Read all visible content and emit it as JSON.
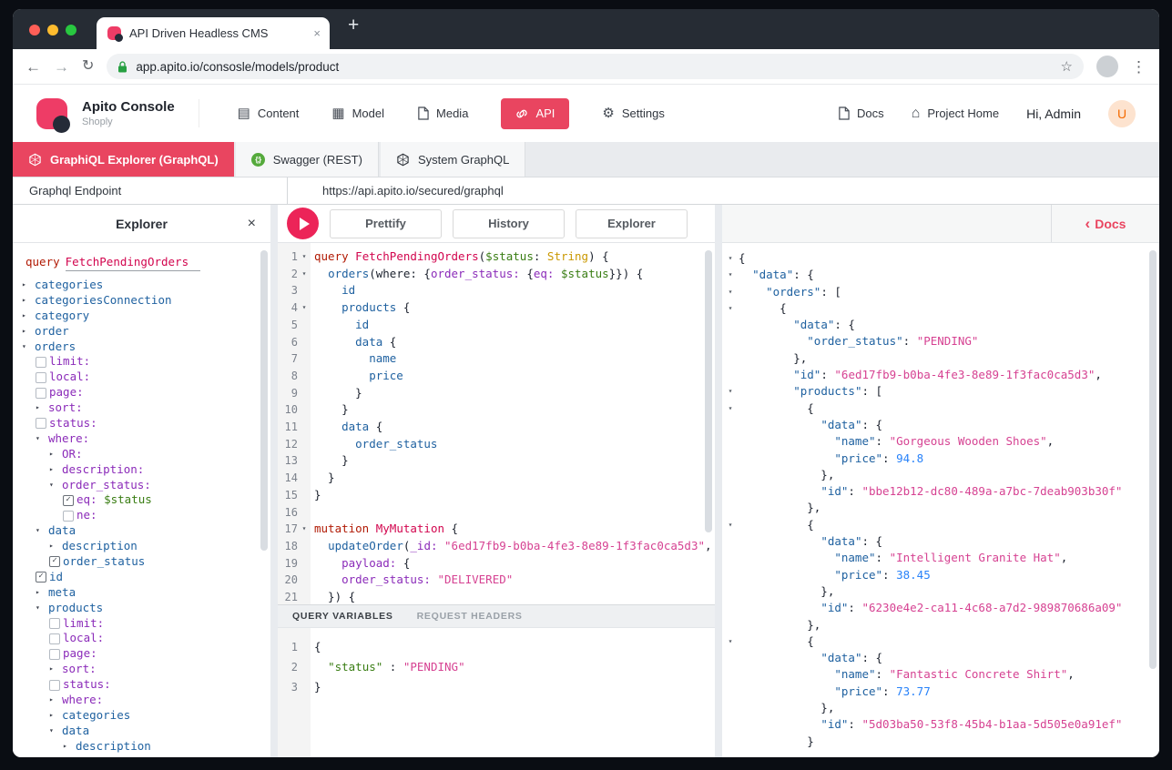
{
  "browser": {
    "tab_title": "API Driven Headless CMS",
    "tab_close": "×",
    "new_tab": "+",
    "back": "←",
    "forward": "→",
    "reload": "↻",
    "url": "app.apito.io/consosle/models/product",
    "star": "☆",
    "menu": "⋮"
  },
  "nav": {
    "brand": "Apito Console",
    "project": "Shoply",
    "items": [
      {
        "label": "Content"
      },
      {
        "label": "Model"
      },
      {
        "label": "Media"
      },
      {
        "label": "API",
        "active": true
      },
      {
        "label": "Settings"
      }
    ],
    "right": {
      "docs": "Docs",
      "project_home": "Project Home",
      "greeting": "Hi, Admin",
      "avatar": "U"
    }
  },
  "api_tabs": [
    {
      "label": "GraphiQL Explorer (GraphQL)",
      "icon": "graphql-icon",
      "active": true
    },
    {
      "label": "Swagger (REST)",
      "icon": "swagger-icon",
      "active": false
    },
    {
      "label": "System GraphQL",
      "icon": "graphql-icon",
      "active": false
    }
  ],
  "endpoint": {
    "label": "Graphql Endpoint",
    "url": "https://api.apito.io/secured/graphql"
  },
  "toolbar": {
    "explorer_title": "Explorer",
    "explorer_close": "×",
    "prettify": "Prettify",
    "history": "History",
    "explorer_btn": "Explorer",
    "docs_chevron": "‹",
    "docs": "Docs"
  },
  "variables_header": {
    "query_variables": "QUERY VARIABLES",
    "request_headers": "REQUEST HEADERS"
  },
  "colors": {
    "accent": "#e94560",
    "play_button": "#ec2458",
    "swagger_green": "#55aa3c",
    "lock_green": "#27a042",
    "traffic_lights": [
      "#ff5f57",
      "#febc2e",
      "#28c840"
    ],
    "avatar_bg": "#fde3cf",
    "avatar_text": "#f56a00",
    "syntax": {
      "keyword": "#b11a04",
      "def": "#d2054e",
      "field": "#1f61a0",
      "argument": "#8b2bb9",
      "variable": "#397d13",
      "type": "#ca9800",
      "string": "#d64292",
      "number": "#2882f9"
    }
  },
  "explorer_tree": {
    "operation": {
      "keyword": "query",
      "name": "FetchPendingOrders"
    },
    "rows": [
      {
        "i": 0,
        "m": "r",
        "t": [
          [
            "categories",
            "fld"
          ]
        ]
      },
      {
        "i": 0,
        "m": "r",
        "t": [
          [
            "categoriesConnection",
            "fld"
          ]
        ]
      },
      {
        "i": 0,
        "m": "r",
        "t": [
          [
            "category",
            "fld"
          ]
        ]
      },
      {
        "i": 0,
        "m": "r",
        "t": [
          [
            "order",
            "fld"
          ]
        ]
      },
      {
        "i": 0,
        "m": "d",
        "t": [
          [
            "orders",
            "fld"
          ]
        ]
      },
      {
        "i": 1,
        "c": false,
        "t": [
          [
            "limit:",
            "attr"
          ]
        ]
      },
      {
        "i": 1,
        "c": false,
        "t": [
          [
            "local:",
            "attr"
          ]
        ]
      },
      {
        "i": 1,
        "c": false,
        "t": [
          [
            "page:",
            "attr"
          ]
        ]
      },
      {
        "i": 1,
        "m": "r",
        "t": [
          [
            "sort:",
            "attr"
          ]
        ]
      },
      {
        "i": 1,
        "c": false,
        "t": [
          [
            "status:",
            "attr"
          ]
        ]
      },
      {
        "i": 1,
        "m": "d",
        "t": [
          [
            "where:",
            "attr"
          ]
        ]
      },
      {
        "i": 2,
        "m": "r",
        "t": [
          [
            "OR:",
            "attr"
          ]
        ]
      },
      {
        "i": 2,
        "m": "r",
        "t": [
          [
            "description:",
            "attr"
          ]
        ]
      },
      {
        "i": 2,
        "m": "d",
        "t": [
          [
            "order_status:",
            "attr"
          ]
        ]
      },
      {
        "i": 3,
        "c": true,
        "t": [
          [
            "eq:",
            "attr"
          ],
          [
            " ",
            "pl"
          ],
          [
            "$status",
            "var"
          ]
        ]
      },
      {
        "i": 3,
        "c": false,
        "t": [
          [
            "ne:",
            "attr"
          ]
        ]
      },
      {
        "i": 1,
        "m": "d",
        "t": [
          [
            "data",
            "fld"
          ]
        ]
      },
      {
        "i": 2,
        "m": "r",
        "t": [
          [
            "description",
            "fld"
          ]
        ]
      },
      {
        "i": 2,
        "c": true,
        "t": [
          [
            "order_status",
            "fld"
          ]
        ]
      },
      {
        "i": 1,
        "c": true,
        "t": [
          [
            "id",
            "fld"
          ]
        ]
      },
      {
        "i": 1,
        "m": "r",
        "t": [
          [
            "meta",
            "fld"
          ]
        ]
      },
      {
        "i": 1,
        "m": "d",
        "t": [
          [
            "products",
            "fld"
          ]
        ]
      },
      {
        "i": 2,
        "c": false,
        "t": [
          [
            "limit:",
            "attr"
          ]
        ]
      },
      {
        "i": 2,
        "c": false,
        "t": [
          [
            "local:",
            "attr"
          ]
        ]
      },
      {
        "i": 2,
        "c": false,
        "t": [
          [
            "page:",
            "attr"
          ]
        ]
      },
      {
        "i": 2,
        "m": "r",
        "t": [
          [
            "sort:",
            "attr"
          ]
        ]
      },
      {
        "i": 2,
        "c": false,
        "t": [
          [
            "status:",
            "attr"
          ]
        ]
      },
      {
        "i": 2,
        "m": "r",
        "t": [
          [
            "where:",
            "attr"
          ]
        ]
      },
      {
        "i": 2,
        "m": "r",
        "t": [
          [
            "categories",
            "fld"
          ]
        ]
      },
      {
        "i": 2,
        "m": "d",
        "t": [
          [
            "data",
            "fld"
          ]
        ]
      },
      {
        "i": 3,
        "m": "r",
        "t": [
          [
            "description",
            "fld"
          ]
        ]
      }
    ]
  },
  "editor": {
    "lines": [
      {
        "f": true,
        "t": [
          [
            "query",
            "kw"
          ],
          [
            " ",
            "pl"
          ],
          [
            "FetchPendingOrders",
            "def"
          ],
          [
            "(",
            "pl"
          ],
          [
            "$status",
            "var"
          ],
          [
            ": ",
            "pl"
          ],
          [
            "String",
            "type"
          ],
          [
            ") {",
            "pl"
          ]
        ]
      },
      {
        "f": true,
        "t": [
          [
            "  ",
            "pl"
          ],
          [
            "orders",
            "fld"
          ],
          [
            "(where: {",
            "pl"
          ],
          [
            "order_status:",
            "attr"
          ],
          [
            " {",
            "pl"
          ],
          [
            "eq:",
            "attr"
          ],
          [
            " ",
            "pl"
          ],
          [
            "$status",
            "var"
          ],
          [
            "}}) {",
            "pl"
          ]
        ]
      },
      {
        "t": [
          [
            "    id",
            "fld"
          ]
        ]
      },
      {
        "f": true,
        "t": [
          [
            "    ",
            "pl"
          ],
          [
            "products",
            "fld"
          ],
          [
            " {",
            "pl"
          ]
        ]
      },
      {
        "t": [
          [
            "      id",
            "fld"
          ]
        ]
      },
      {
        "t": [
          [
            "      ",
            "pl"
          ],
          [
            "data",
            "fld"
          ],
          [
            " {",
            "pl"
          ]
        ]
      },
      {
        "t": [
          [
            "        name",
            "fld"
          ]
        ]
      },
      {
        "t": [
          [
            "        price",
            "fld"
          ]
        ]
      },
      {
        "t": [
          [
            "      }",
            "pl"
          ]
        ]
      },
      {
        "t": [
          [
            "    }",
            "pl"
          ]
        ]
      },
      {
        "t": [
          [
            "    ",
            "pl"
          ],
          [
            "data",
            "fld"
          ],
          [
            " {",
            "pl"
          ]
        ]
      },
      {
        "t": [
          [
            "      order_status",
            "fld"
          ]
        ]
      },
      {
        "t": [
          [
            "    }",
            "pl"
          ]
        ]
      },
      {
        "t": [
          [
            "  }",
            "pl"
          ]
        ]
      },
      {
        "t": [
          [
            "}",
            "pl"
          ]
        ]
      },
      {
        "t": []
      },
      {
        "f": true,
        "t": [
          [
            "mutation",
            "kw"
          ],
          [
            " ",
            "pl"
          ],
          [
            "MyMutation",
            "def"
          ],
          [
            " {",
            "pl"
          ]
        ]
      },
      {
        "t": [
          [
            "  ",
            "pl"
          ],
          [
            "updateOrder",
            "fld"
          ],
          [
            "(",
            "pl"
          ],
          [
            "_id:",
            "attr"
          ],
          [
            " ",
            "pl"
          ],
          [
            "\"6ed17fb9-b0ba-4fe3-8e89-1f3fac0ca5d3\"",
            "str"
          ],
          [
            ",",
            "pl"
          ]
        ]
      },
      {
        "t": [
          [
            "    ",
            "pl"
          ],
          [
            "payload:",
            "attr"
          ],
          [
            " {",
            "pl"
          ]
        ]
      },
      {
        "t": [
          [
            "    ",
            "pl"
          ],
          [
            "order_status:",
            "attr"
          ],
          [
            " ",
            "pl"
          ],
          [
            "\"DELIVERED\"",
            "str"
          ]
        ]
      },
      {
        "t": [
          [
            "  }) {",
            "pl"
          ]
        ]
      }
    ]
  },
  "variables": {
    "lines": [
      {
        "t": [
          [
            "{",
            "pl"
          ]
        ]
      },
      {
        "t": [
          [
            "  ",
            "pl"
          ],
          [
            "\"status\"",
            "var"
          ],
          [
            " : ",
            "pl"
          ],
          [
            "\"PENDING\"",
            "str"
          ]
        ]
      },
      {
        "t": [
          [
            "}",
            "pl"
          ]
        ]
      }
    ]
  },
  "results": {
    "lines": [
      {
        "f": true,
        "t": [
          [
            "{",
            "pl"
          ]
        ]
      },
      {
        "f": true,
        "t": [
          [
            "  ",
            "pl"
          ],
          [
            "\"data\"",
            "fld"
          ],
          [
            ": {",
            "pl"
          ]
        ]
      },
      {
        "f": true,
        "t": [
          [
            "    ",
            "pl"
          ],
          [
            "\"orders\"",
            "fld"
          ],
          [
            ": [",
            "pl"
          ]
        ]
      },
      {
        "f": true,
        "t": [
          [
            "      {",
            "pl"
          ]
        ]
      },
      {
        "t": [
          [
            "        ",
            "pl"
          ],
          [
            "\"data\"",
            "fld"
          ],
          [
            ": {",
            "pl"
          ]
        ]
      },
      {
        "t": [
          [
            "          ",
            "pl"
          ],
          [
            "\"order_status\"",
            "fld"
          ],
          [
            ": ",
            "pl"
          ],
          [
            "\"PENDING\"",
            "str"
          ]
        ]
      },
      {
        "t": [
          [
            "        },",
            "pl"
          ]
        ]
      },
      {
        "t": [
          [
            "        ",
            "pl"
          ],
          [
            "\"id\"",
            "fld"
          ],
          [
            ": ",
            "pl"
          ],
          [
            "\"6ed17fb9-b0ba-4fe3-8e89-1f3fac0ca5d3\"",
            "str"
          ],
          [
            ",",
            "pl"
          ]
        ]
      },
      {
        "f": true,
        "t": [
          [
            "        ",
            "pl"
          ],
          [
            "\"products\"",
            "fld"
          ],
          [
            ": [",
            "pl"
          ]
        ]
      },
      {
        "f": true,
        "t": [
          [
            "          {",
            "pl"
          ]
        ]
      },
      {
        "t": [
          [
            "            ",
            "pl"
          ],
          [
            "\"data\"",
            "fld"
          ],
          [
            ": {",
            "pl"
          ]
        ]
      },
      {
        "t": [
          [
            "              ",
            "pl"
          ],
          [
            "\"name\"",
            "fld"
          ],
          [
            ": ",
            "pl"
          ],
          [
            "\"Gorgeous Wooden Shoes\"",
            "str"
          ],
          [
            ",",
            "pl"
          ]
        ]
      },
      {
        "t": [
          [
            "              ",
            "pl"
          ],
          [
            "\"price\"",
            "fld"
          ],
          [
            ": ",
            "pl"
          ],
          [
            "94.8",
            "num"
          ]
        ]
      },
      {
        "t": [
          [
            "            },",
            "pl"
          ]
        ]
      },
      {
        "t": [
          [
            "            ",
            "pl"
          ],
          [
            "\"id\"",
            "fld"
          ],
          [
            ": ",
            "pl"
          ],
          [
            "\"bbe12b12-dc80-489a-a7bc-7deab903b30f\"",
            "str"
          ]
        ]
      },
      {
        "t": [
          [
            "          },",
            "pl"
          ]
        ]
      },
      {
        "f": true,
        "t": [
          [
            "          {",
            "pl"
          ]
        ]
      },
      {
        "t": [
          [
            "            ",
            "pl"
          ],
          [
            "\"data\"",
            "fld"
          ],
          [
            ": {",
            "pl"
          ]
        ]
      },
      {
        "t": [
          [
            "              ",
            "pl"
          ],
          [
            "\"name\"",
            "fld"
          ],
          [
            ": ",
            "pl"
          ],
          [
            "\"Intelligent Granite Hat\"",
            "str"
          ],
          [
            ",",
            "pl"
          ]
        ]
      },
      {
        "t": [
          [
            "              ",
            "pl"
          ],
          [
            "\"price\"",
            "fld"
          ],
          [
            ": ",
            "pl"
          ],
          [
            "38.45",
            "num"
          ]
        ]
      },
      {
        "t": [
          [
            "            },",
            "pl"
          ]
        ]
      },
      {
        "t": [
          [
            "            ",
            "pl"
          ],
          [
            "\"id\"",
            "fld"
          ],
          [
            ": ",
            "pl"
          ],
          [
            "\"6230e4e2-ca11-4c68-a7d2-989870686a09\"",
            "str"
          ]
        ]
      },
      {
        "t": [
          [
            "          },",
            "pl"
          ]
        ]
      },
      {
        "f": true,
        "t": [
          [
            "          {",
            "pl"
          ]
        ]
      },
      {
        "t": [
          [
            "            ",
            "pl"
          ],
          [
            "\"data\"",
            "fld"
          ],
          [
            ": {",
            "pl"
          ]
        ]
      },
      {
        "t": [
          [
            "              ",
            "pl"
          ],
          [
            "\"name\"",
            "fld"
          ],
          [
            ": ",
            "pl"
          ],
          [
            "\"Fantastic Concrete Shirt\"",
            "str"
          ],
          [
            ",",
            "pl"
          ]
        ]
      },
      {
        "t": [
          [
            "              ",
            "pl"
          ],
          [
            "\"price\"",
            "fld"
          ],
          [
            ": ",
            "pl"
          ],
          [
            "73.77",
            "num"
          ]
        ]
      },
      {
        "t": [
          [
            "            },",
            "pl"
          ]
        ]
      },
      {
        "t": [
          [
            "            ",
            "pl"
          ],
          [
            "\"id\"",
            "fld"
          ],
          [
            ": ",
            "pl"
          ],
          [
            "\"5d03ba50-53f8-45b4-b1aa-5d505e0a91ef\"",
            "str"
          ]
        ]
      },
      {
        "t": [
          [
            "          }",
            "pl"
          ]
        ]
      }
    ]
  }
}
